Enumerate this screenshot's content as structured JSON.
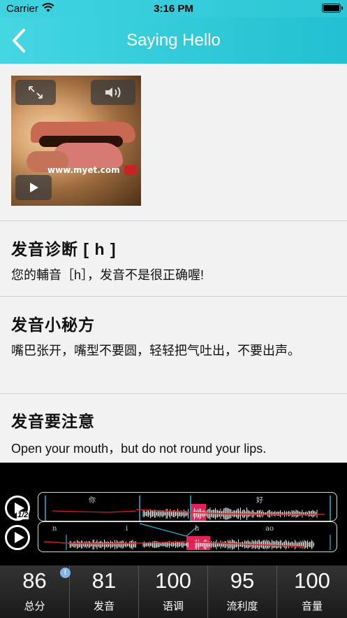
{
  "status_bar": {
    "carrier": "Carrier",
    "time": "3:16 PM"
  },
  "nav": {
    "title": "Saying Hello",
    "back_icon": "chevron-left-icon"
  },
  "video": {
    "watermark": "www.myet.com",
    "icons": [
      "expand-icon",
      "speaker-icon",
      "play-icon"
    ]
  },
  "sections": [
    {
      "heading": "发音诊断  [ h ]",
      "body": "您的輔音［h］，发音不是很正确喔!"
    },
    {
      "heading": "发音小秘方",
      "body": "嘴巴张开，嘴型不要圆，轻轻把气吐出，不要出声。"
    },
    {
      "heading": "发音要注意",
      "body": "Open your mouth，but do not round your lips."
    }
  ],
  "waveforms": {
    "top": {
      "speed_label": "1/2",
      "words": [
        "你",
        "好"
      ]
    },
    "bottom": {
      "phonemes": [
        "n",
        "i",
        "h",
        "ao"
      ]
    },
    "colors": {
      "highlight": "#e0245a",
      "pitch_line": "#d92020",
      "marker": "#2ab4d8"
    }
  },
  "scores": [
    {
      "value": "86",
      "label": "总分"
    },
    {
      "value": "81",
      "label": "发音"
    },
    {
      "value": "100",
      "label": "语调"
    },
    {
      "value": "95",
      "label": "流利度"
    },
    {
      "value": "100",
      "label": "音量"
    }
  ],
  "info_badge": "!"
}
